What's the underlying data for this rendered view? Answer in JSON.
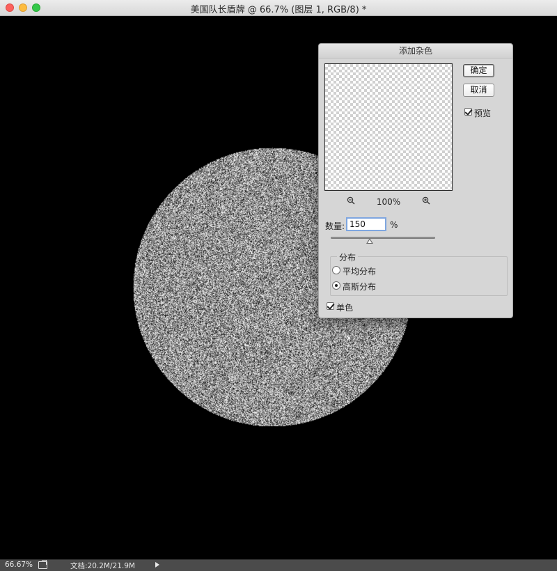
{
  "window": {
    "title": "美国队长盾牌 @ 66.7% (图层 1, RGB/8) *"
  },
  "status": {
    "zoom": "66.67%",
    "doc_info": "文档:20.2M/21.9M"
  },
  "dialog": {
    "title": "添加杂色",
    "ok_label": "确定",
    "cancel_label": "取消",
    "preview_label": "预览",
    "preview_checked": true,
    "zoom_percent": "100%",
    "amount_label": "数量:",
    "amount_value": "150",
    "amount_unit": "%",
    "amount_slider_fraction": 0.375,
    "distribution": {
      "title": "分布",
      "options": [
        "平均分布",
        "高斯分布"
      ],
      "selected": "高斯分布"
    },
    "monochrome_label": "单色",
    "monochrome_checked": true
  }
}
